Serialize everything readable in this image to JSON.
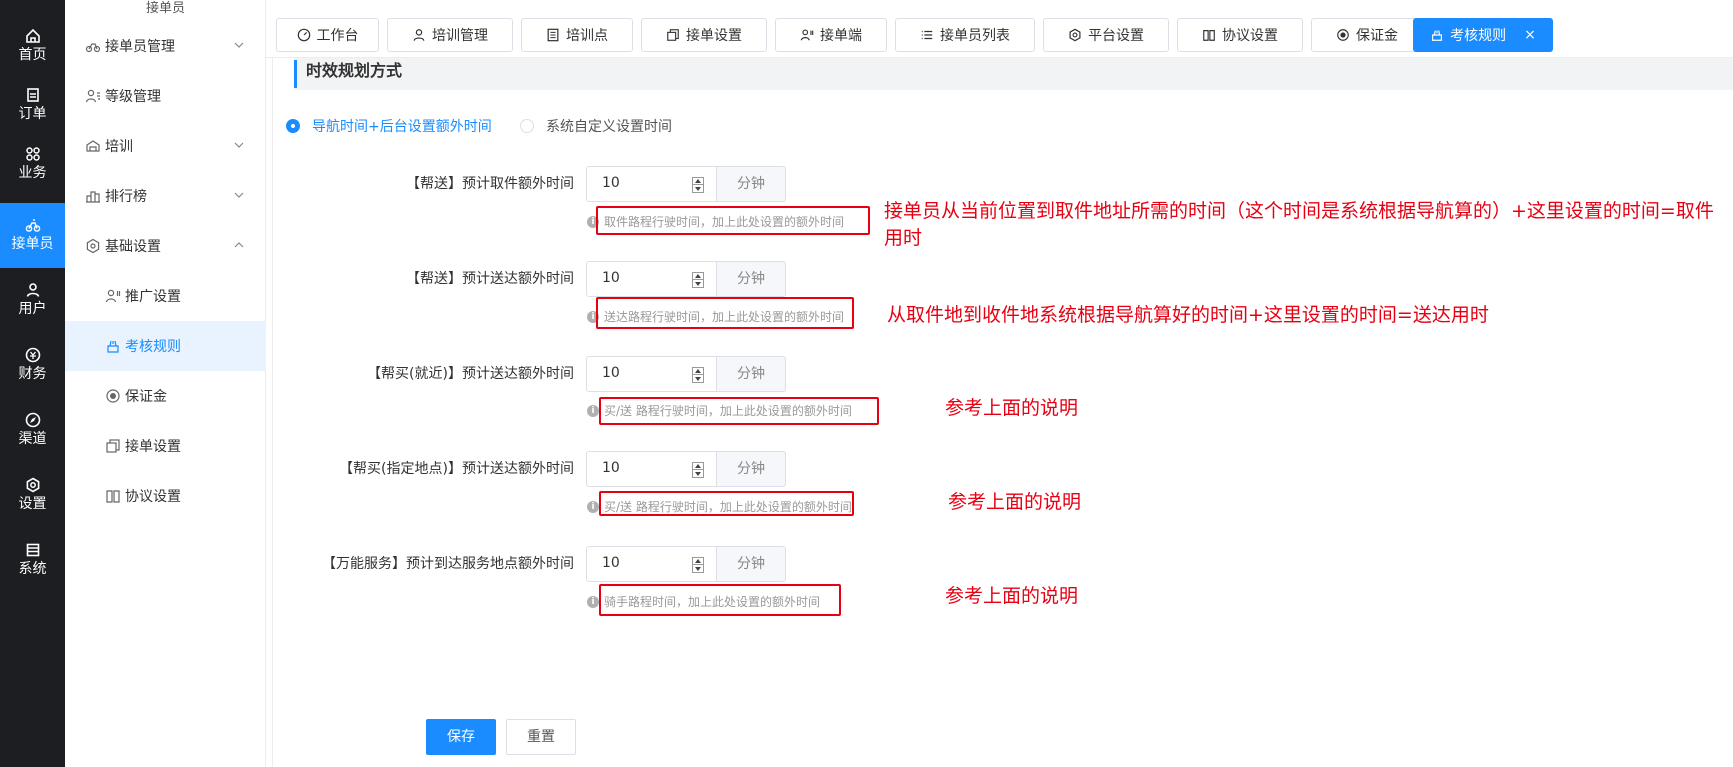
{
  "rail": {
    "items": [
      {
        "label": "首页",
        "icon": "home-icon"
      },
      {
        "label": "订单",
        "icon": "order-icon"
      },
      {
        "label": "业务",
        "icon": "grid-icon"
      },
      {
        "label": "接单员",
        "icon": "rider-icon",
        "active": true
      },
      {
        "label": "用户",
        "icon": "user-icon"
      },
      {
        "label": "财务",
        "icon": "finance-icon"
      },
      {
        "label": "渠道",
        "icon": "channel-icon"
      },
      {
        "label": "设置",
        "icon": "settings-icon"
      },
      {
        "label": "系统",
        "icon": "system-icon"
      }
    ]
  },
  "sidebar": {
    "top_label": "接单员",
    "items": [
      {
        "label": "接单员管理",
        "icon": "rider-icon",
        "expandable": true,
        "expanded": false
      },
      {
        "label": "等级管理",
        "icon": "level-icon"
      },
      {
        "label": "培训",
        "icon": "training-icon",
        "expandable": true,
        "expanded": false
      },
      {
        "label": "排行榜",
        "icon": "rank-icon",
        "expandable": true,
        "expanded": false
      },
      {
        "label": "基础设置",
        "icon": "settings-icon",
        "expandable": true,
        "expanded": true
      },
      {
        "label": "推广设置",
        "icon": "promote-icon",
        "sub": true
      },
      {
        "label": "考核规则",
        "icon": "rule-icon",
        "sub": true,
        "active": true
      },
      {
        "label": "保证金",
        "icon": "deposit-icon",
        "sub": true
      },
      {
        "label": "接单设置",
        "icon": "order-setting-icon",
        "sub": true
      },
      {
        "label": "协议设置",
        "icon": "agreement-icon",
        "sub": true
      }
    ]
  },
  "tabs": [
    {
      "label": "工作台",
      "icon": "dashboard-icon"
    },
    {
      "label": "培训管理",
      "icon": "user-icon"
    },
    {
      "label": "培训点",
      "icon": "list-icon"
    },
    {
      "label": "接单设置",
      "icon": "copy-icon"
    },
    {
      "label": "接单端",
      "icon": "rider-icon"
    },
    {
      "label": "接单员列表",
      "icon": "list-icon"
    },
    {
      "label": "平台设置",
      "icon": "settings-icon"
    },
    {
      "label": "协议设置",
      "icon": "book-icon"
    },
    {
      "label": "保证金",
      "icon": "deposit-icon"
    },
    {
      "label": "考核规则",
      "icon": "rule-icon",
      "active": true,
      "closable": true,
      "close_symbol": "×"
    }
  ],
  "section": {
    "title": "时效规划方式"
  },
  "radios": [
    {
      "label": "导航时间+后台设置额外时间",
      "checked": true
    },
    {
      "label": "系统自定义设置时间",
      "checked": false
    }
  ],
  "form": {
    "unit": "分钟",
    "info_icon": "i",
    "rows": [
      {
        "label": "【帮送】预计取件额外时间",
        "value": "10",
        "hint": "取件路程行驶时间，加上此处设置的额外时间"
      },
      {
        "label": "【帮送】预计送达额外时间",
        "value": "10",
        "hint": "送达路程行驶时间，加上此处设置的额外时间"
      },
      {
        "label": "【帮买(就近)】预计送达额外时间",
        "value": "10",
        "hint": "买/送 路程行驶时间，加上此处设置的额外时间"
      },
      {
        "label": "【帮买(指定地点)】预计送达额外时间",
        "value": "10",
        "hint": "买/送 路程行驶时间，加上此处设置的额外时间"
      },
      {
        "label": "【万能服务】预计到达服务地点额外时间",
        "value": "10",
        "hint": "骑手路程时间，加上此处设置的额外时间"
      }
    ]
  },
  "annotations": [
    {
      "text": "接单员从当前位置到取件地址所需的时间（这个时间是系统根据导航算的）+这里设置的时间=取件用时"
    },
    {
      "text": "从取件地到收件地系统根据导航算好的时间+这里设置的时间=送达用时"
    },
    {
      "text": "参考上面的说明"
    },
    {
      "text": "参考上面的说明"
    },
    {
      "text": "参考上面的说明"
    }
  ],
  "buttons": {
    "save": "保存",
    "reset": "重置"
  },
  "colors": {
    "accent": "#1a8cff",
    "annotation": "#e60012",
    "rail_bg": "#1d1e22"
  }
}
